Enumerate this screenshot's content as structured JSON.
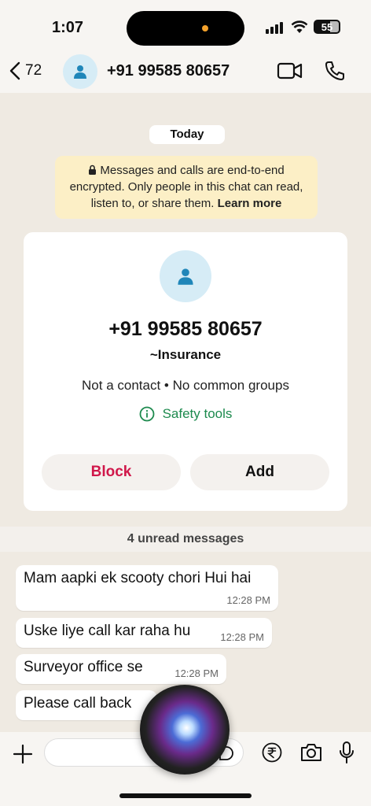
{
  "status": {
    "time": "1:07",
    "battery": "55"
  },
  "header": {
    "back_count": "72",
    "contact": "+91 99585 80657"
  },
  "chat": {
    "date": "Today",
    "encryption_notice": "Messages and calls are end-to-end encrypted. Only people in this chat can read, listen to, or share them.",
    "learn_more": "Learn more"
  },
  "card": {
    "number": "+91 99585 80657",
    "alias": "~Insurance",
    "info": "Not a contact • No common groups",
    "safety_tools": "Safety tools",
    "block_label": "Block",
    "add_label": "Add"
  },
  "unread": "4 unread messages",
  "messages": [
    {
      "text": "Mam aapki ek scooty chori Hui hai",
      "time": "12:28 PM"
    },
    {
      "text": "Uske liye call kar raha hu",
      "time": "12:28 PM"
    },
    {
      "text": "Surveyor office se",
      "time": "12:28 PM"
    },
    {
      "text": "Please call back",
      "time": ""
    }
  ],
  "icons": {
    "back": "chevron-left-icon",
    "video": "video-call-icon",
    "phone": "phone-icon",
    "info": "info-icon",
    "plus": "plus-icon",
    "sticker": "sticker-icon",
    "payment": "rupee-icon",
    "camera": "camera-icon",
    "mic": "microphone-icon",
    "siri": "siri-orb"
  },
  "colors": {
    "block": "#d0174a",
    "safety": "#1d8a4e",
    "notice_bg": "#fcefc6"
  }
}
